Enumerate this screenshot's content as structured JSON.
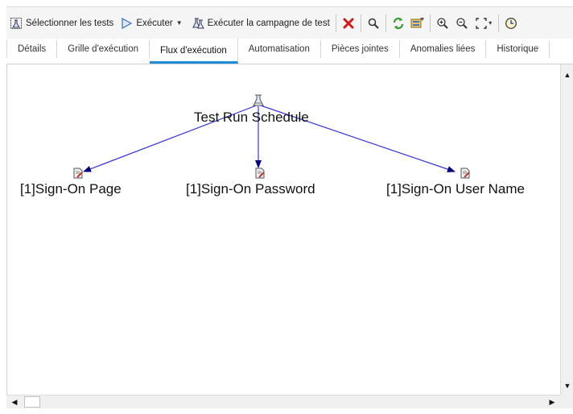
{
  "toolbar": {
    "select_tests": "Sélectionner les tests",
    "run": "Exécuter",
    "run_campaign": "Exécuter la campagne de test",
    "icons": [
      "select-tests-icon",
      "run-icon",
      "run-campaign-icon",
      "delete-icon",
      "find-icon",
      "refresh-icon",
      "filter-icon",
      "zoom-in-icon",
      "zoom-out-icon",
      "fit-icon",
      "clock-icon"
    ]
  },
  "tabs": [
    {
      "label": "Détails"
    },
    {
      "label": "Grille d'exécution"
    },
    {
      "label": "Flux d'exécution"
    },
    {
      "label": "Automatisation"
    },
    {
      "label": "Pièces jointes"
    },
    {
      "label": "Anomalies liées"
    },
    {
      "label": "Historique"
    }
  ],
  "active_tab": "Flux d'exécution",
  "flow": {
    "root": {
      "label": "Test Run Schedule"
    },
    "children": [
      {
        "label": "[1]Sign-On Page"
      },
      {
        "label": "[1]Sign-On Password"
      },
      {
        "label": "[1]Sign-On User Name"
      }
    ]
  },
  "colors": {
    "accent": "#1e8fd6",
    "edge": "#3333dd",
    "arrowhead": "#000080"
  }
}
